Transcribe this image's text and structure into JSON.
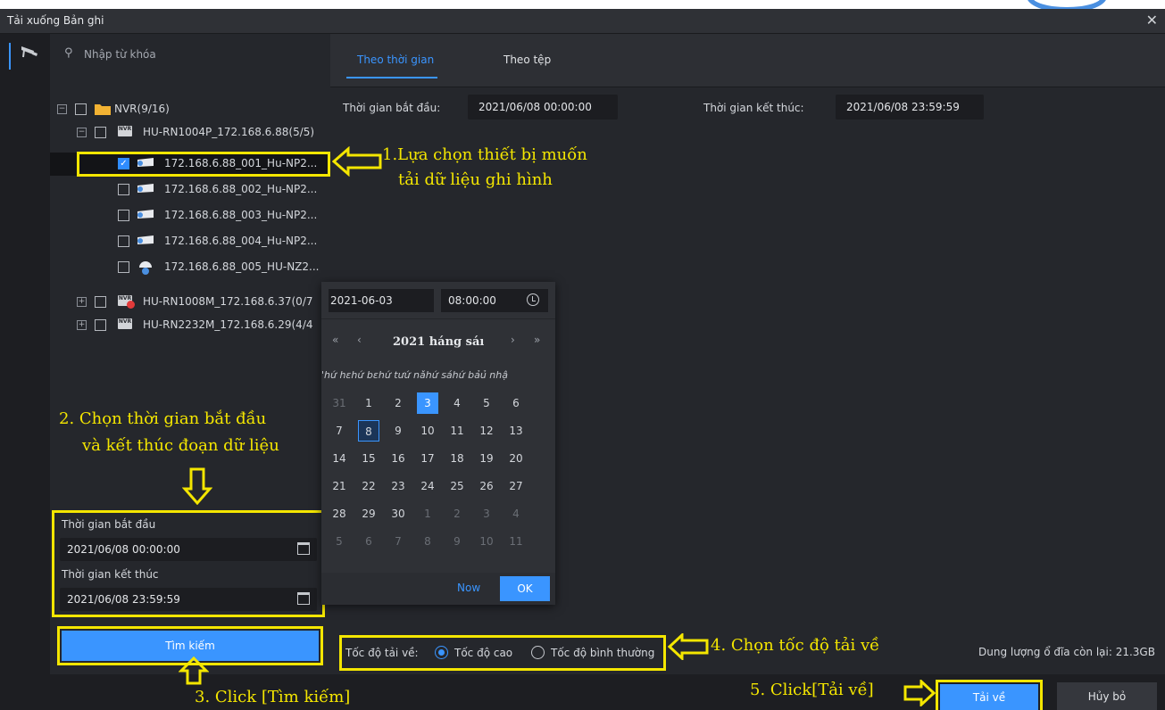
{
  "window": {
    "title": "Tải xuống Bản ghi",
    "close_glyph": "✕"
  },
  "search": {
    "placeholder": "Nhập từ khóa",
    "icon": "search-icon"
  },
  "tree": {
    "root": {
      "label": "NVR(9/16)",
      "expander": "−"
    },
    "device1": {
      "label": "HU-RN1004P_172.168.6.88(5/5)",
      "expander": "−"
    },
    "channels": [
      {
        "label": "172.168.6.88_001_Hu-NP2...",
        "checked": true
      },
      {
        "label": "172.168.6.88_002_Hu-NP2...",
        "checked": false
      },
      {
        "label": "172.168.6.88_003_Hu-NP2...",
        "checked": false
      },
      {
        "label": "172.168.6.88_004_Hu-NP2...",
        "checked": false
      },
      {
        "label": "172.168.6.88_005_HU-NZ2...",
        "checked": false
      }
    ],
    "device2": {
      "label": "HU-RN1008M_172.168.6.37(0/7",
      "expander": "+"
    },
    "device3": {
      "label": "HU-RN2232M_172.168.6.29(4/4",
      "expander": "+"
    },
    "nvr_badge": "NVR"
  },
  "left_time": {
    "start_label": "Thời gian bắt đầu",
    "start_value": "2021/06/08 00:00:00",
    "end_label": "Thời gian kết thúc",
    "end_value": "2021/06/08 23:59:59"
  },
  "search_button": "Tìm kiếm",
  "tabs": [
    {
      "label": "Theo thời gian",
      "active": true
    },
    {
      "label": "Theo tệp",
      "active": false
    }
  ],
  "main_time": {
    "start_label": "Thời gian bắt đầu:",
    "start_value": "2021/06/08 00:00:00",
    "end_label": "Thời gian kết thúc:",
    "end_value": "2021/06/08 23:59:59"
  },
  "calendar": {
    "date_value": "2021-06-03",
    "time_value": "08:00:00",
    "month_title": "2021 háng sáı",
    "nav": {
      "prev_year": "«",
      "prev_month": "‹",
      "next_month": "›",
      "next_year": "»"
    },
    "weekdays_text": "'hứ hɛhứ bɛhứ tưứ nǎhứ sáhứ bảủ nhậ",
    "weeks": [
      [
        "31",
        "1",
        "2",
        "3",
        "4",
        "5",
        "6"
      ],
      [
        "7",
        "8",
        "9",
        "10",
        "11",
        "12",
        "13"
      ],
      [
        "14",
        "15",
        "16",
        "17",
        "18",
        "19",
        "20"
      ],
      [
        "21",
        "22",
        "23",
        "24",
        "25",
        "26",
        "27"
      ],
      [
        "28",
        "29",
        "30",
        "1",
        "2",
        "3",
        "4"
      ],
      [
        "5",
        "6",
        "7",
        "8",
        "9",
        "10",
        "11"
      ]
    ],
    "selected_day": "3",
    "today_day": "8",
    "now_label": "Now",
    "ok_label": "OK"
  },
  "speed": {
    "label": "Tốc độ tải về:",
    "options": [
      {
        "label": "Tốc độ cao",
        "selected": true
      },
      {
        "label": "Tốc độ bình thường",
        "selected": false
      }
    ]
  },
  "disk": "Dung lượng ổ đĩa còn lại: 21.3GB",
  "buttons": {
    "download": "Tải về",
    "cancel": "Hủy bỏ"
  },
  "annotations": {
    "a1_line1": "1.Lựa chọn thiết bị muốn",
    "a1_line2": "tải dữ liệu ghi hình",
    "a2_line1": "2. Chọn thời gian bắt đầu",
    "a2_line2": "và kết thúc đoạn dữ liệu",
    "a3": "3. Click [Tìm kiếm]",
    "a4": "4. Chọn tốc độ tải về",
    "a5": "5. Click[Tải về]"
  },
  "colors": {
    "accent": "#3a95ff",
    "highlight": "#f4e600",
    "background": "#25272c"
  }
}
